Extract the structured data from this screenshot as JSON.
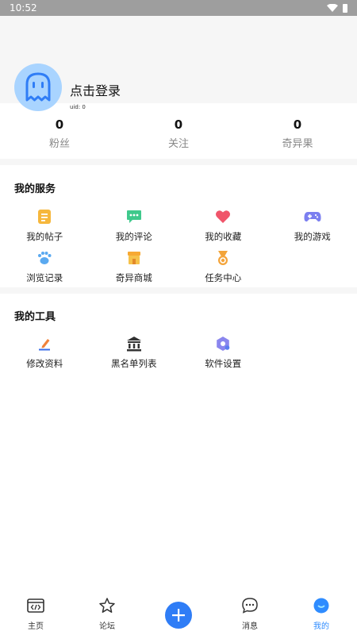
{
  "status_bar": {
    "time": "10:52"
  },
  "profile": {
    "login_text": "点击登录",
    "uid": "uid: 0"
  },
  "stats": [
    {
      "value": "0",
      "label": "粉丝"
    },
    {
      "value": "0",
      "label": "关注"
    },
    {
      "value": "0",
      "label": "奇异果"
    }
  ],
  "services": {
    "title": "我的服务",
    "items": [
      {
        "label": "我的帖子",
        "icon": "posts-icon"
      },
      {
        "label": "我的评论",
        "icon": "comments-icon"
      },
      {
        "label": "我的收藏",
        "icon": "heart-icon"
      },
      {
        "label": "我的游戏",
        "icon": "gamepad-icon"
      },
      {
        "label": "浏览记录",
        "icon": "paw-icon"
      },
      {
        "label": "奇异商城",
        "icon": "shop-icon"
      },
      {
        "label": "任务中心",
        "icon": "medal-icon"
      }
    ]
  },
  "tools": {
    "title": "我的工具",
    "items": [
      {
        "label": "修改资料",
        "icon": "edit-icon"
      },
      {
        "label": "黑名单列表",
        "icon": "building-icon"
      },
      {
        "label": "软件设置",
        "icon": "settings-icon"
      }
    ]
  },
  "tabs": [
    {
      "label": "主页",
      "icon": "code-icon"
    },
    {
      "label": "论坛",
      "icon": "star-icon"
    },
    {
      "label": "",
      "icon": "plus-icon"
    },
    {
      "label": "消息",
      "icon": "message-icon"
    },
    {
      "label": "我的",
      "icon": "profile-icon"
    }
  ],
  "colors": {
    "accent": "#2f7df6",
    "active_tab": "#2f8cff",
    "avatar_bg": "#a9d4ff"
  }
}
